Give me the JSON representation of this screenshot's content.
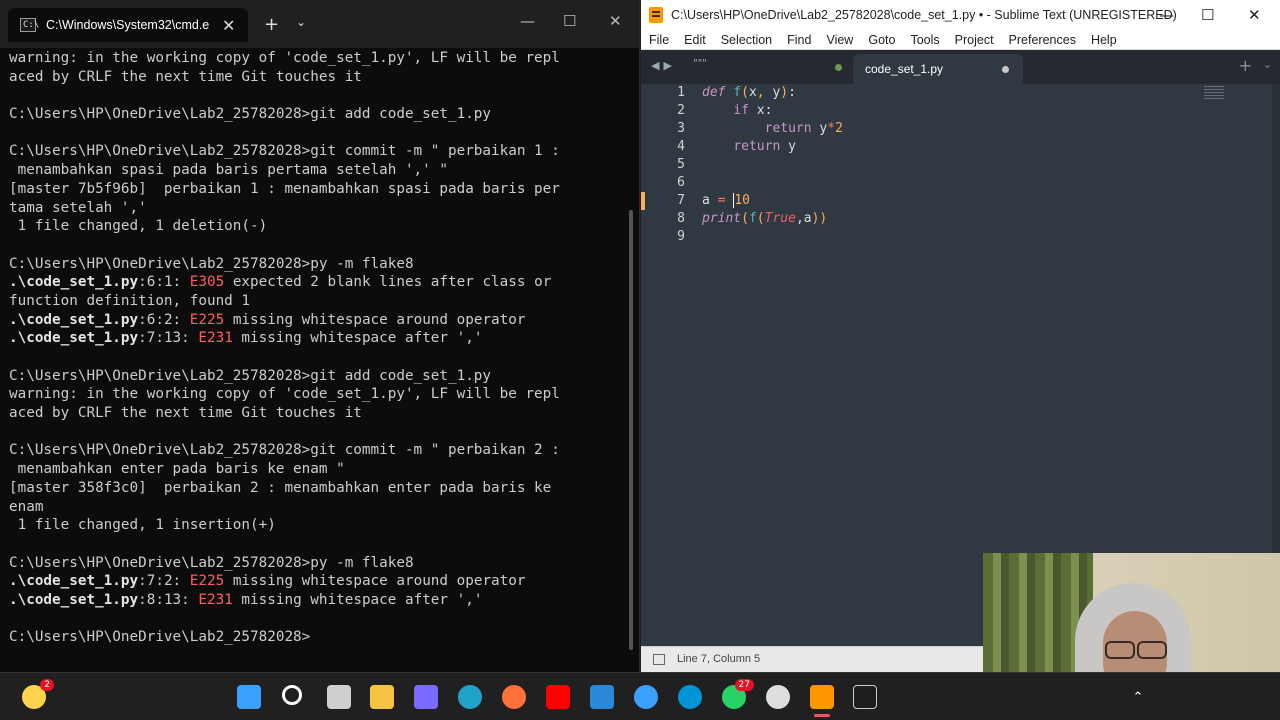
{
  "cmd": {
    "tab_title": "C:\\Windows\\System32\\cmd.e",
    "lines": [
      [
        {
          "t": "warning: in the working copy of 'code_set_1.py', LF will be repl"
        }
      ],
      [
        {
          "t": "aced by CRLF the next time Git touches it"
        }
      ],
      [
        {
          "t": ""
        }
      ],
      [
        {
          "t": "C:\\Users\\HP\\OneDrive\\Lab2_25782028>git add code_set_1.py"
        }
      ],
      [
        {
          "t": ""
        }
      ],
      [
        {
          "t": "C:\\Users\\HP\\OneDrive\\Lab2_25782028>git commit -m \" perbaikan 1 :"
        }
      ],
      [
        {
          "t": " menambahkan spasi pada baris pertama setelah ',' \""
        }
      ],
      [
        {
          "t": "[master 7b5f96b]  perbaikan 1 : menambahkan spasi pada baris per"
        }
      ],
      [
        {
          "t": "tama setelah ','"
        }
      ],
      [
        {
          "t": " 1 file changed, 1 deletion(-)"
        }
      ],
      [
        {
          "t": ""
        }
      ],
      [
        {
          "t": "C:\\Users\\HP\\OneDrive\\Lab2_25782028>py -m flake8"
        }
      ],
      [
        {
          "t": ".\\code_set_1.py",
          "c": "file"
        },
        {
          "t": ":6:1: ",
          "c": "pos"
        },
        {
          "t": "E305",
          "c": "code"
        },
        {
          "t": " expected 2 blank lines after class or"
        }
      ],
      [
        {
          "t": "function definition, found 1"
        }
      ],
      [
        {
          "t": ".\\code_set_1.py",
          "c": "file"
        },
        {
          "t": ":6:2: ",
          "c": "pos"
        },
        {
          "t": "E225",
          "c": "code"
        },
        {
          "t": " missing whitespace around operator"
        }
      ],
      [
        {
          "t": ".\\code_set_1.py",
          "c": "file"
        },
        {
          "t": ":7:13: ",
          "c": "pos"
        },
        {
          "t": "E231",
          "c": "code"
        },
        {
          "t": " missing whitespace after ','"
        }
      ],
      [
        {
          "t": ""
        }
      ],
      [
        {
          "t": "C:\\Users\\HP\\OneDrive\\Lab2_25782028>git add code_set_1.py"
        }
      ],
      [
        {
          "t": "warning: in the working copy of 'code_set_1.py', LF will be repl"
        }
      ],
      [
        {
          "t": "aced by CRLF the next time Git touches it"
        }
      ],
      [
        {
          "t": ""
        }
      ],
      [
        {
          "t": "C:\\Users\\HP\\OneDrive\\Lab2_25782028>git commit -m \" perbaikan 2 :"
        }
      ],
      [
        {
          "t": " menambahkan enter pada baris ke enam \""
        }
      ],
      [
        {
          "t": "[master 358f3c0]  perbaikan 2 : menambahkan enter pada baris ke"
        }
      ],
      [
        {
          "t": "enam"
        }
      ],
      [
        {
          "t": " 1 file changed, 1 insertion(+)"
        }
      ],
      [
        {
          "t": ""
        }
      ],
      [
        {
          "t": "C:\\Users\\HP\\OneDrive\\Lab2_25782028>py -m flake8"
        }
      ],
      [
        {
          "t": ".\\code_set_1.py",
          "c": "file"
        },
        {
          "t": ":7:2: ",
          "c": "pos"
        },
        {
          "t": "E225",
          "c": "code"
        },
        {
          "t": " missing whitespace around operator"
        }
      ],
      [
        {
          "t": ".\\code_set_1.py",
          "c": "file"
        },
        {
          "t": ":8:13: ",
          "c": "pos"
        },
        {
          "t": "E231",
          "c": "code"
        },
        {
          "t": " missing whitespace after ','"
        }
      ],
      [
        {
          "t": ""
        }
      ],
      [
        {
          "t": "C:\\Users\\HP\\OneDrive\\Lab2_25782028>"
        }
      ]
    ]
  },
  "sublime": {
    "title": "C:\\Users\\HP\\OneDrive\\Lab2_25782028\\code_set_1.py • - Sublime Text (UNREGISTERED)",
    "menu": [
      "File",
      "Edit",
      "Selection",
      "Find",
      "View",
      "Goto",
      "Tools",
      "Project",
      "Preferences",
      "Help"
    ],
    "inactive_tab": "\"\"\"",
    "active_tab": "code_set_1.py",
    "line_numbers": [
      "1",
      "2",
      "3",
      "4",
      "5",
      "6",
      "7",
      "8",
      "9"
    ],
    "code_lines": [
      [
        {
          "t": "def",
          "c": "kw"
        },
        {
          "t": " "
        },
        {
          "t": "f",
          "c": "fn"
        },
        {
          "t": "(",
          "c": "par"
        },
        {
          "t": "x"
        },
        {
          "t": ",",
          "c": "par"
        },
        {
          "t": " "
        },
        {
          "t": "y"
        },
        {
          "t": ")",
          "c": "par"
        },
        {
          "t": ":"
        }
      ],
      [
        {
          "t": "    "
        },
        {
          "t": "if",
          "c": "kwn"
        },
        {
          "t": " x:"
        }
      ],
      [
        {
          "t": "        "
        },
        {
          "t": "return",
          "c": "kwn"
        },
        {
          "t": " y"
        },
        {
          "t": "*",
          "c": "op"
        },
        {
          "t": "2",
          "c": "num"
        }
      ],
      [
        {
          "t": "    "
        },
        {
          "t": "return",
          "c": "kwn"
        },
        {
          "t": " y"
        }
      ],
      [
        {
          "t": ""
        }
      ],
      [
        {
          "t": ""
        }
      ],
      [
        {
          "t": "a "
        },
        {
          "t": "=",
          "c": "op"
        },
        {
          "t": " "
        },
        {
          "t": "CARET"
        },
        {
          "t": "10",
          "c": "num"
        }
      ],
      [
        {
          "t": "print",
          "c": "kw"
        },
        {
          "t": "(",
          "c": "par"
        },
        {
          "t": "f",
          "c": "fn"
        },
        {
          "t": "(",
          "c": "par"
        },
        {
          "t": "True",
          "c": "bool"
        },
        {
          "t": ",a"
        },
        {
          "t": "))",
          "c": "par"
        }
      ],
      [
        {
          "t": ""
        }
      ]
    ],
    "status": "Line 7, Column 5"
  },
  "taskbar": {
    "icons": [
      {
        "name": "copilot-icon",
        "color": "#ffd34d",
        "badge": "2"
      },
      {
        "name": "windows-start-icon",
        "color": "#3aa0ff"
      },
      {
        "name": "search-icon",
        "color": "#ffffff"
      },
      {
        "name": "task-view-icon",
        "color": "#cfcfcf"
      },
      {
        "name": "file-explorer-icon",
        "color": "#f6c343"
      },
      {
        "name": "copilot-app-icon",
        "color": "#7b6cff"
      },
      {
        "name": "edge-icon",
        "color": "#1fa3c9"
      },
      {
        "name": "firefox-icon",
        "color": "#ff7139"
      },
      {
        "name": "youtube-icon",
        "color": "#ff0000"
      },
      {
        "name": "store-icon",
        "color": "#2b88d8"
      },
      {
        "name": "help-icon",
        "color": "#3aa0ff"
      },
      {
        "name": "hp-icon",
        "color": "#0096d6"
      },
      {
        "name": "whatsapp-icon",
        "color": "#25d366",
        "badge": "27"
      },
      {
        "name": "obs-icon",
        "color": "#dddddd"
      },
      {
        "name": "sublime-taskbar-icon",
        "color": "#ff9800"
      },
      {
        "name": "terminal-taskbar-icon",
        "color": "#cccccc"
      }
    ]
  }
}
